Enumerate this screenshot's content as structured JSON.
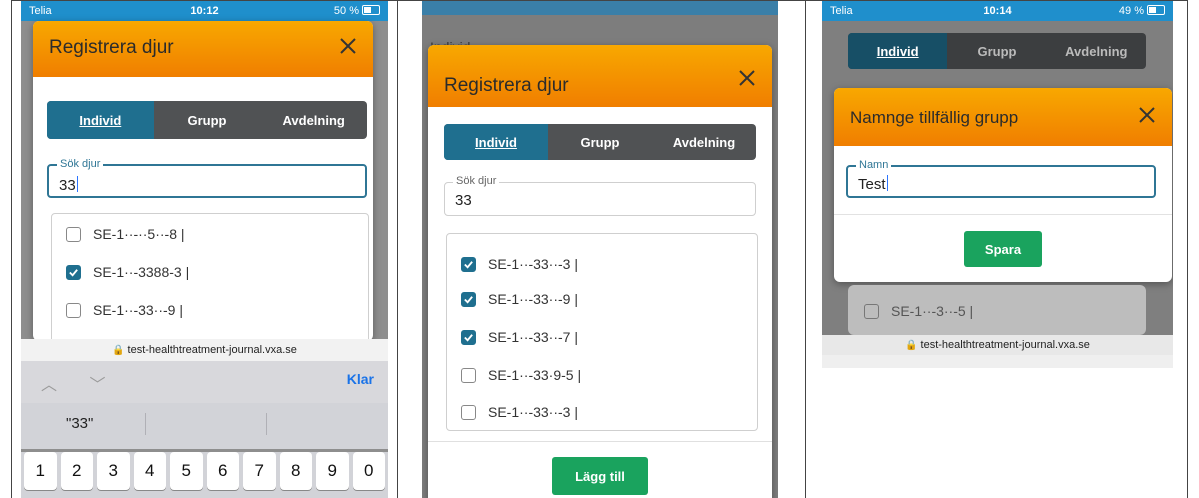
{
  "shot1": {
    "status": {
      "carrier": "Telia",
      "time": "10:12",
      "battery": "50 %"
    },
    "modal_title": "Registrera djur",
    "tabs": [
      "Individ",
      "Grupp",
      "Avdelning"
    ],
    "search": {
      "label": "Sök djur",
      "value": "33"
    },
    "items": [
      {
        "id": "SE-1··-··5··-8 |",
        "checked": false
      },
      {
        "id": "SE-1··-3388-3 |",
        "checked": true
      },
      {
        "id": "SE-1··-33··-9 |",
        "checked": false
      }
    ],
    "url": "test-healthtreatment-journal.vxa.se",
    "keyboard": {
      "arrows": "︿ ﹀",
      "done": "Klar",
      "suggestion": "\"33\"",
      "keys": [
        "1",
        "2",
        "3",
        "4",
        "5",
        "6",
        "7",
        "8",
        "9",
        "0"
      ]
    }
  },
  "shot2": {
    "modal_title": "Registrera djur",
    "bg_text": "Individ",
    "tabs": [
      "Individ",
      "Grupp",
      "Avdelning"
    ],
    "search": {
      "label": "Sök djur",
      "value": "33"
    },
    "items": [
      {
        "id": "SE-1··-33··-3 |",
        "checked": true
      },
      {
        "id": "SE-1··-33··-9 |",
        "checked": true
      },
      {
        "id": "SE-1··-33··-7 |",
        "checked": true
      },
      {
        "id": "SE-1··-33·9-5 |",
        "checked": false
      },
      {
        "id": "SE-1··-33··-3 |",
        "checked": false
      }
    ],
    "add_button": "Lägg till"
  },
  "shot3": {
    "status": {
      "carrier": "Telia",
      "time": "10:14",
      "battery": "49 %"
    },
    "tabs": [
      "Individ",
      "Grupp",
      "Avdelning"
    ],
    "modal_title": "Namnge tillfällig grupp",
    "name_field": {
      "label": "Namn",
      "value": "Test"
    },
    "save_button": "Spara",
    "bg_item": "SE-1··-3··-5 |",
    "url": "test-healthtreatment-journal.vxa.se"
  },
  "colors": {
    "header_orange": "#f59a00",
    "tab_active": "#1f6f8f",
    "tab_bg": "#505254",
    "button_green": "#1aa35e"
  }
}
